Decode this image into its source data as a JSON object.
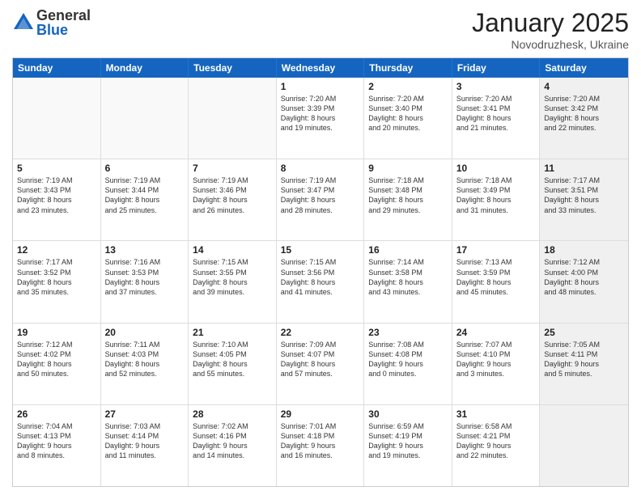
{
  "logo": {
    "general": "General",
    "blue": "Blue"
  },
  "title": "January 2025",
  "location": "Novodruzhesk, Ukraine",
  "days": [
    "Sunday",
    "Monday",
    "Tuesday",
    "Wednesday",
    "Thursday",
    "Friday",
    "Saturday"
  ],
  "rows": [
    [
      {
        "day": "",
        "text": "",
        "empty": true
      },
      {
        "day": "",
        "text": "",
        "empty": true
      },
      {
        "day": "",
        "text": "",
        "empty": true
      },
      {
        "day": "1",
        "text": "Sunrise: 7:20 AM\nSunset: 3:39 PM\nDaylight: 8 hours\nand 19 minutes."
      },
      {
        "day": "2",
        "text": "Sunrise: 7:20 AM\nSunset: 3:40 PM\nDaylight: 8 hours\nand 20 minutes."
      },
      {
        "day": "3",
        "text": "Sunrise: 7:20 AM\nSunset: 3:41 PM\nDaylight: 8 hours\nand 21 minutes."
      },
      {
        "day": "4",
        "text": "Sunrise: 7:20 AM\nSunset: 3:42 PM\nDaylight: 8 hours\nand 22 minutes.",
        "shaded": true
      }
    ],
    [
      {
        "day": "5",
        "text": "Sunrise: 7:19 AM\nSunset: 3:43 PM\nDaylight: 8 hours\nand 23 minutes."
      },
      {
        "day": "6",
        "text": "Sunrise: 7:19 AM\nSunset: 3:44 PM\nDaylight: 8 hours\nand 25 minutes."
      },
      {
        "day": "7",
        "text": "Sunrise: 7:19 AM\nSunset: 3:46 PM\nDaylight: 8 hours\nand 26 minutes."
      },
      {
        "day": "8",
        "text": "Sunrise: 7:19 AM\nSunset: 3:47 PM\nDaylight: 8 hours\nand 28 minutes."
      },
      {
        "day": "9",
        "text": "Sunrise: 7:18 AM\nSunset: 3:48 PM\nDaylight: 8 hours\nand 29 minutes."
      },
      {
        "day": "10",
        "text": "Sunrise: 7:18 AM\nSunset: 3:49 PM\nDaylight: 8 hours\nand 31 minutes."
      },
      {
        "day": "11",
        "text": "Sunrise: 7:17 AM\nSunset: 3:51 PM\nDaylight: 8 hours\nand 33 minutes.",
        "shaded": true
      }
    ],
    [
      {
        "day": "12",
        "text": "Sunrise: 7:17 AM\nSunset: 3:52 PM\nDaylight: 8 hours\nand 35 minutes."
      },
      {
        "day": "13",
        "text": "Sunrise: 7:16 AM\nSunset: 3:53 PM\nDaylight: 8 hours\nand 37 minutes."
      },
      {
        "day": "14",
        "text": "Sunrise: 7:15 AM\nSunset: 3:55 PM\nDaylight: 8 hours\nand 39 minutes."
      },
      {
        "day": "15",
        "text": "Sunrise: 7:15 AM\nSunset: 3:56 PM\nDaylight: 8 hours\nand 41 minutes."
      },
      {
        "day": "16",
        "text": "Sunrise: 7:14 AM\nSunset: 3:58 PM\nDaylight: 8 hours\nand 43 minutes."
      },
      {
        "day": "17",
        "text": "Sunrise: 7:13 AM\nSunset: 3:59 PM\nDaylight: 8 hours\nand 45 minutes."
      },
      {
        "day": "18",
        "text": "Sunrise: 7:12 AM\nSunset: 4:00 PM\nDaylight: 8 hours\nand 48 minutes.",
        "shaded": true
      }
    ],
    [
      {
        "day": "19",
        "text": "Sunrise: 7:12 AM\nSunset: 4:02 PM\nDaylight: 8 hours\nand 50 minutes."
      },
      {
        "day": "20",
        "text": "Sunrise: 7:11 AM\nSunset: 4:03 PM\nDaylight: 8 hours\nand 52 minutes."
      },
      {
        "day": "21",
        "text": "Sunrise: 7:10 AM\nSunset: 4:05 PM\nDaylight: 8 hours\nand 55 minutes."
      },
      {
        "day": "22",
        "text": "Sunrise: 7:09 AM\nSunset: 4:07 PM\nDaylight: 8 hours\nand 57 minutes."
      },
      {
        "day": "23",
        "text": "Sunrise: 7:08 AM\nSunset: 4:08 PM\nDaylight: 9 hours\nand 0 minutes."
      },
      {
        "day": "24",
        "text": "Sunrise: 7:07 AM\nSunset: 4:10 PM\nDaylight: 9 hours\nand 3 minutes."
      },
      {
        "day": "25",
        "text": "Sunrise: 7:05 AM\nSunset: 4:11 PM\nDaylight: 9 hours\nand 5 minutes.",
        "shaded": true
      }
    ],
    [
      {
        "day": "26",
        "text": "Sunrise: 7:04 AM\nSunset: 4:13 PM\nDaylight: 9 hours\nand 8 minutes."
      },
      {
        "day": "27",
        "text": "Sunrise: 7:03 AM\nSunset: 4:14 PM\nDaylight: 9 hours\nand 11 minutes."
      },
      {
        "day": "28",
        "text": "Sunrise: 7:02 AM\nSunset: 4:16 PM\nDaylight: 9 hours\nand 14 minutes."
      },
      {
        "day": "29",
        "text": "Sunrise: 7:01 AM\nSunset: 4:18 PM\nDaylight: 9 hours\nand 16 minutes."
      },
      {
        "day": "30",
        "text": "Sunrise: 6:59 AM\nSunset: 4:19 PM\nDaylight: 9 hours\nand 19 minutes."
      },
      {
        "day": "31",
        "text": "Sunrise: 6:58 AM\nSunset: 4:21 PM\nDaylight: 9 hours\nand 22 minutes."
      },
      {
        "day": "",
        "text": "",
        "empty": true,
        "shaded": true
      }
    ]
  ]
}
